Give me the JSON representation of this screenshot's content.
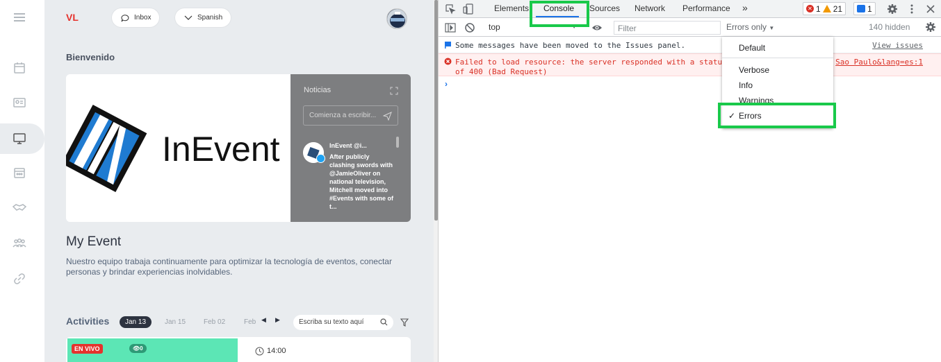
{
  "app": {
    "initials": "VL",
    "inbox_label": "Inbox",
    "language_label": "Spanish",
    "welcome": "Bienvenido",
    "logo_text": "InEvent",
    "news": {
      "title": "Noticias",
      "input_placeholder": "Comienza a escribir...",
      "tweet_author": "InEvent @i...",
      "tweet_text": "After publicly clashing swords with @JamieOliver on national television, Mitchell moved into #Events with some of t..."
    },
    "event_title": "My Event",
    "event_description": "Nuestro equipo trabaja continuamente para optimizar la tecnología de eventos, conectar personas y brindar experiencias inolvidables.",
    "activities": {
      "title": "Activities",
      "dates": [
        "Jan 13",
        "Jan 15",
        "Feb 02",
        "Feb"
      ],
      "search_placeholder": "Escriba su texto aquí",
      "card": {
        "live_badge": "EN VIVO",
        "viewers": "0",
        "time": "14:00"
      }
    },
    "sidebar_icons": [
      "menu-icon",
      "calendar-icon",
      "id-card-icon",
      "monitor-icon",
      "agenda-icon",
      "handshake-icon",
      "people-icon",
      "link-icon"
    ]
  },
  "devtools": {
    "tabs": [
      "Elements",
      "Console",
      "Sources",
      "Network",
      "Performance"
    ],
    "active_tab": "Console",
    "more_tabs": "»",
    "error_count": "1",
    "warning_count": "21",
    "issue_count": "1",
    "context": "top",
    "filter_placeholder": "Filter",
    "levels_label": "Errors only",
    "hidden_count": "140 hidden",
    "messages": [
      {
        "type": "info",
        "text": "Some messages have been moved to the Issues panel.",
        "link": "View issues"
      },
      {
        "type": "error",
        "text": "Failed to load resource: the server responded with a statu\nof 400 (Bad Request)",
        "link": "Sao Paulo&lang=es:1"
      }
    ],
    "prompt": "›",
    "level_menu": {
      "items": [
        "Default",
        "Verbose",
        "Info",
        "Warnings",
        "Errors"
      ],
      "checked": "Errors",
      "check_mark": "✓"
    },
    "highlight_color": "#19c94a"
  }
}
